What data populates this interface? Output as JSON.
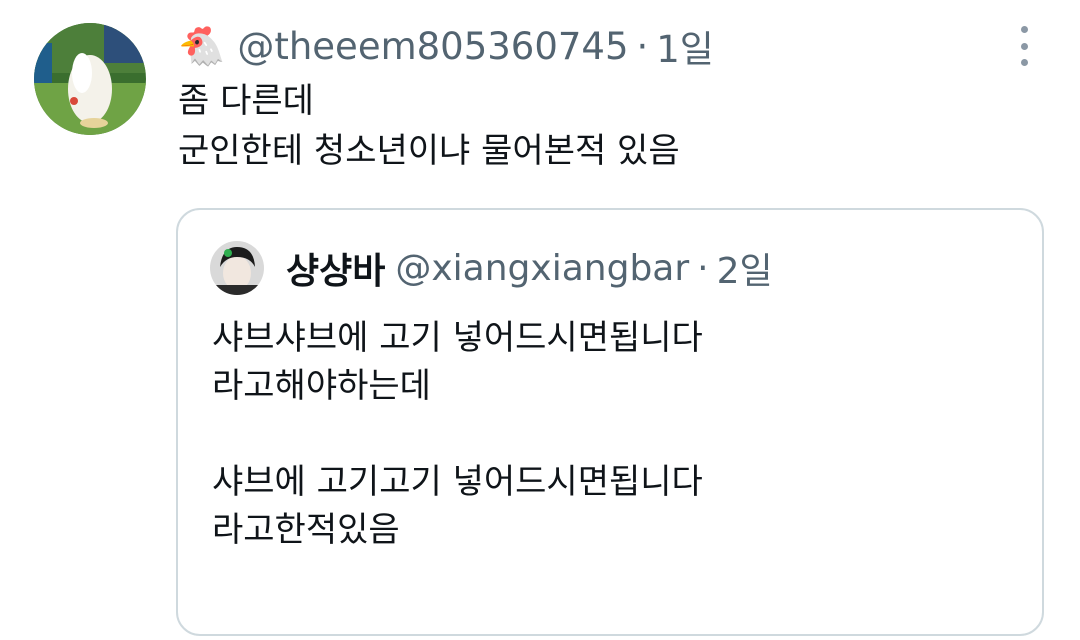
{
  "tweet": {
    "emoji": "🐔",
    "handle": "@theeem805360745",
    "separator": "·",
    "time": "1일",
    "lines": [
      "좀 다른데",
      "군인한테 청소년이냐 물어본적 있음"
    ]
  },
  "quoted_tweet": {
    "display_name": "샹샹바",
    "handle": "@xiangxiangbar",
    "separator": "·",
    "time": "2일",
    "lines": [
      "샤브샤브에 고기 넣어드시면됩니다",
      "라고해야하는데",
      "",
      "샤브에 고기고기 넣어드시면됩니다",
      "라고한적있음"
    ]
  },
  "icons": {
    "more": "more-vertical-icon",
    "avatar": "user-avatar",
    "quoted_avatar": "quoted-user-avatar"
  }
}
